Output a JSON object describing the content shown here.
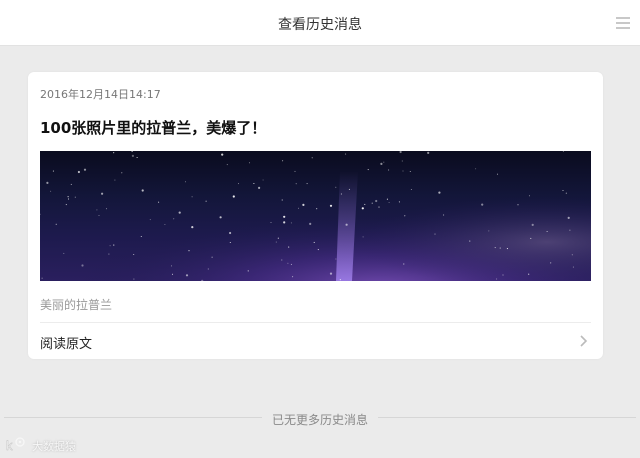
{
  "header": {
    "title": "查看历史消息",
    "menu_icon": "menu-icon"
  },
  "card": {
    "date": "2016年12月14日14:17",
    "headline": "100张照片里的拉普兰，美爆了！",
    "cover_image": "starry-night-sky",
    "caption": "美丽的拉普兰",
    "read_more_label": "阅读原文",
    "read_more_icon": "chevron-right-icon"
  },
  "footer": {
    "end_text": "已无更多历史消息"
  },
  "watermark": {
    "logo": "watermark-logo",
    "text": "大数据猿"
  },
  "colors": {
    "background": "#ebebeb",
    "card": "#ffffff",
    "muted_text": "#999999"
  }
}
